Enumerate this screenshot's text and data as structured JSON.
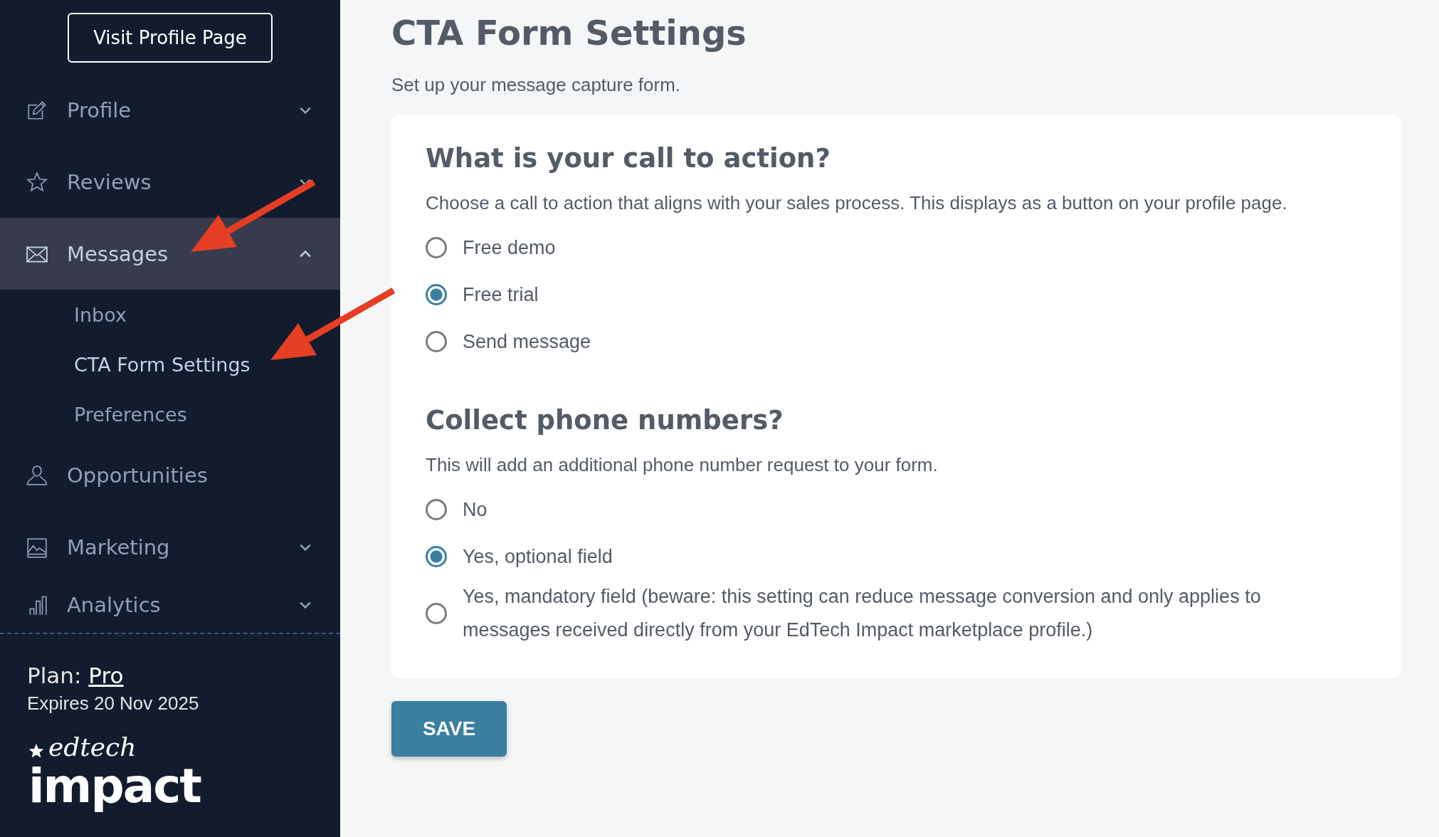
{
  "sidebar": {
    "profile_button": "Visit Profile Page",
    "nav": [
      {
        "label": "Profile",
        "kind": "group",
        "expanded": false,
        "selected": false,
        "pointer": false
      },
      {
        "label": "Reviews",
        "kind": "group",
        "expanded": false,
        "selected": false,
        "pointer": false
      },
      {
        "label": "Messages",
        "kind": "group",
        "expanded": true,
        "selected": true,
        "pointer": true,
        "children": [
          {
            "label": "Inbox",
            "selected": false,
            "pointer": false
          },
          {
            "label": "CTA Form Settings",
            "selected": true,
            "pointer": true
          },
          {
            "label": "Preferences",
            "selected": false,
            "pointer": false
          }
        ]
      },
      {
        "label": "Opportunities",
        "kind": "link",
        "selected": false,
        "pointer": false
      },
      {
        "label": "Marketing",
        "kind": "group",
        "expanded": false,
        "selected": false,
        "pointer": false
      },
      {
        "label": "Analytics",
        "kind": "group",
        "expanded": false,
        "selected": false,
        "pointer": false
      }
    ],
    "plan": {
      "label": "Plan:",
      "name": "Pro",
      "expires": "Expires 20 Nov 2025"
    },
    "logo": {
      "script": "edtech",
      "word": "impact"
    }
  },
  "page": {
    "title": "CTA Form Settings",
    "subtitle": "Set up your message capture form.",
    "sections": [
      {
        "heading": "What is your call to action?",
        "description": "Choose a call to action that aligns with your sales process. This displays as a button on your profile page.",
        "options": [
          {
            "label": "Free demo",
            "selected": false
          },
          {
            "label": "Free trial",
            "selected": true
          },
          {
            "label": "Send message",
            "selected": false
          }
        ]
      },
      {
        "heading": "Collect phone numbers?",
        "description": "This will add an additional phone number request to your form.",
        "options": [
          {
            "label": "No",
            "selected": false
          },
          {
            "label": "Yes, optional field",
            "selected": true
          },
          {
            "label": "Yes, mandatory field (beware: this setting can reduce message conversion and only applies to messages received directly from your EdTech Impact marketplace profile.)",
            "selected": false
          }
        ]
      }
    ],
    "save_button": "SAVE"
  }
}
